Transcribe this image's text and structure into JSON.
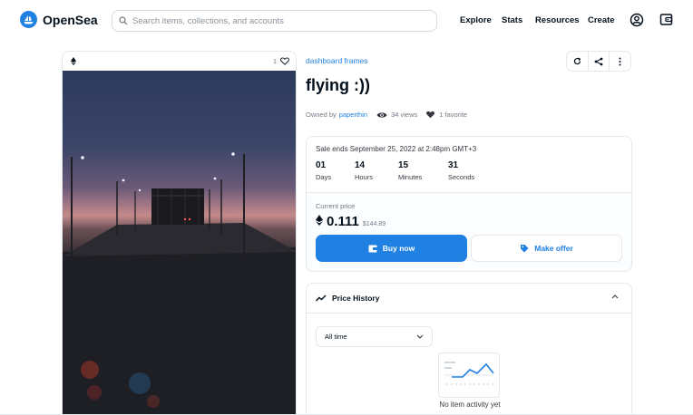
{
  "brand": {
    "name": "OpenSea",
    "color": "#2081e2"
  },
  "search": {
    "placeholder": "Search items, collections, and accounts",
    "value": ""
  },
  "nav": {
    "items": [
      "Explore",
      "Stats",
      "Resources",
      "Create"
    ],
    "icons": [
      "profile-icon",
      "wallet-icon"
    ]
  },
  "asset_card": {
    "currency_icon": "ethereum-icon",
    "favorites_count": "1",
    "image_description_icon": "photo"
  },
  "item": {
    "collection": "dashboard frames",
    "title": "flying :))",
    "owned_by_label": "Owned by",
    "owner": "paperthin",
    "views": "34 views",
    "favorites": "1 favorite"
  },
  "toolbar": {
    "icons": [
      "refresh-icon",
      "share-icon",
      "more-icon"
    ]
  },
  "sale": {
    "ends_text": "Sale ends September 25, 2022 at 2:48pm GMT+3",
    "countdown": [
      {
        "value": "01",
        "label": "Days"
      },
      {
        "value": "14",
        "label": "Hours"
      },
      {
        "value": "15",
        "label": "Minutes"
      },
      {
        "value": "31",
        "label": "Seconds"
      }
    ],
    "current_price_label": "Current price",
    "price": "0.111",
    "usd": "$144.89",
    "buy_label": "Buy now",
    "offer_label": "Make offer"
  },
  "price_history": {
    "title": "Price History",
    "filter_value": "All time",
    "empty_text": "No item activity yet"
  }
}
